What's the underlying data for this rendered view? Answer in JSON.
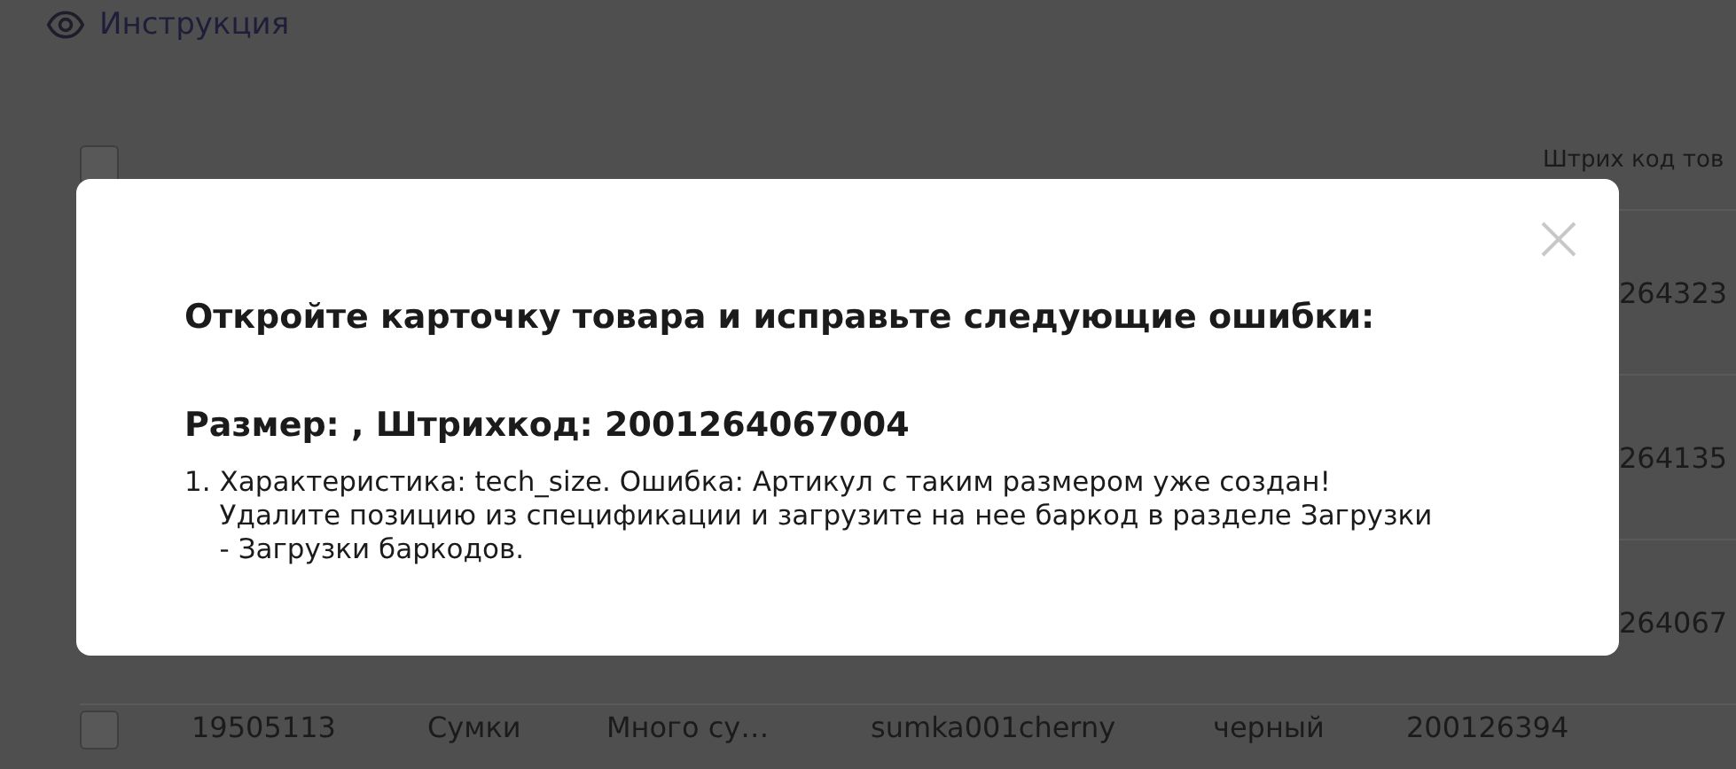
{
  "instruction_link": {
    "label": "Инструкция"
  },
  "table": {
    "header": {
      "checked": false,
      "column_7": "Штрих код тов"
    },
    "rows": [
      {
        "barcode": "264323"
      },
      {
        "barcode": "264135"
      },
      {
        "barcode": "264067"
      },
      {
        "checked": false,
        "cells": [
          "19505113",
          "Сумки",
          "Много су…",
          "sumka001cherny",
          "черный"
        ],
        "barcode": "200126394"
      }
    ]
  },
  "dialog": {
    "title": "Откройте карточку товара и исправьте следующие ошибки:",
    "subtitle": "Размер: , Штрихкод: 2001264067004",
    "errors": [
      {
        "number": "1.",
        "text": "Характеристика: tech_size. Ошибка: Артикул с таким размером уже создан! Удалите позицию из спецификации и загрузите на нее баркод в разделе Загрузки - Загрузки баркодов."
      }
    ]
  }
}
